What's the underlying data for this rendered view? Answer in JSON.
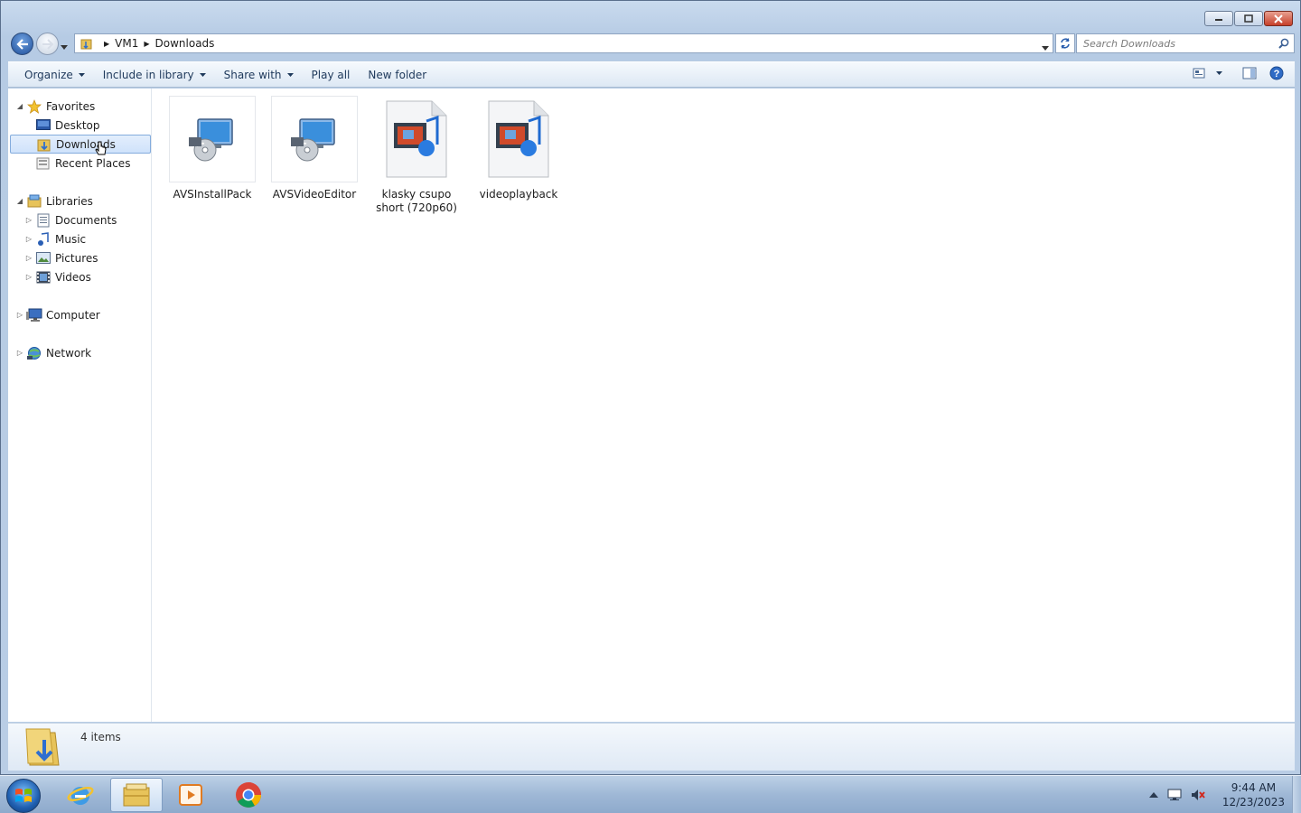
{
  "window": {
    "address": {
      "crumbs": [
        "VM1",
        "Downloads"
      ]
    },
    "search": {
      "placeholder": "Search Downloads"
    }
  },
  "toolbar": {
    "organize": "Organize",
    "include_in_library": "Include in library",
    "share_with": "Share with",
    "play_all": "Play all",
    "new_folder": "New folder"
  },
  "nav_pane": {
    "favorites": "Favorites",
    "desktop": "Desktop",
    "downloads": "Downloads",
    "recent_places": "Recent Places",
    "libraries": "Libraries",
    "documents": "Documents",
    "music": "Music",
    "pictures": "Pictures",
    "videos": "Videos",
    "computer": "Computer",
    "network": "Network"
  },
  "files": [
    {
      "name": "AVSInstallPack",
      "icon": "installer-icon"
    },
    {
      "name": "AVSVideoEditor",
      "icon": "installer-icon"
    },
    {
      "name": "klasky csupo short (720p60)",
      "icon": "media-file-icon"
    },
    {
      "name": "videoplayback",
      "icon": "media-file-icon"
    }
  ],
  "details": {
    "count": "4 items"
  },
  "taskbar": {
    "time": "9:44 AM",
    "date": "12/23/2023",
    "pinned": [
      "internet-explorer-icon",
      "windows-explorer-icon",
      "media-player-icon",
      "chrome-icon"
    ]
  },
  "colors": {
    "selection": "#cfe2fb",
    "selection_border": "#84acdd",
    "toolbar_text": "#1e395b"
  }
}
